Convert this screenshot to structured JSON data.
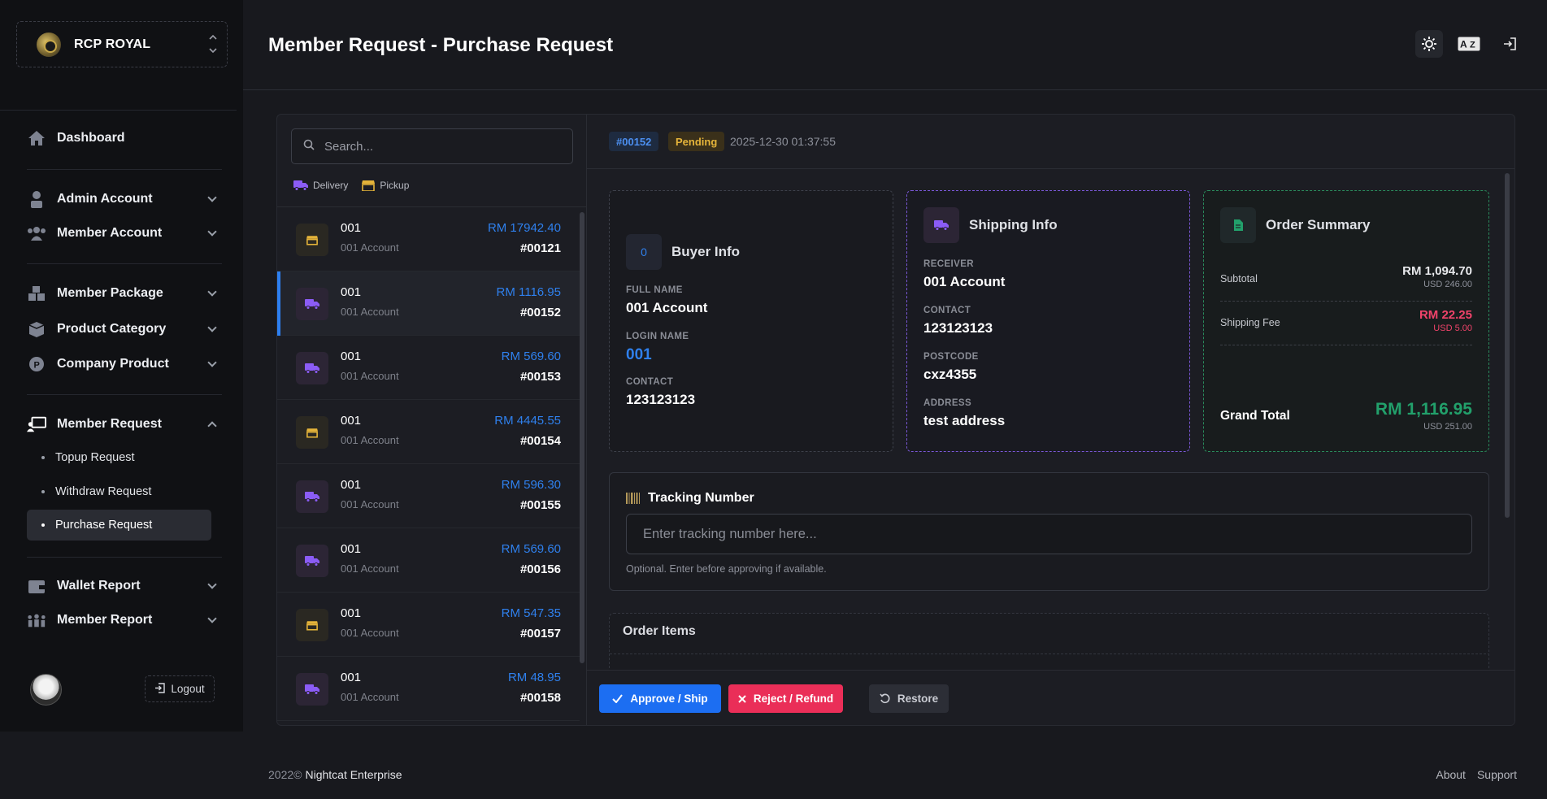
{
  "brand": {
    "name": "RCP ROYAL"
  },
  "sidebar": {
    "dashboard": "Dashboard",
    "admin_account": "Admin Account",
    "member_account": "Member Account",
    "member_package": "Member Package",
    "product_category": "Product Category",
    "company_product": "Company Product",
    "member_request": "Member Request",
    "sub_items": [
      "Topup Request",
      "Withdraw Request",
      "Purchase Request"
    ],
    "wallet_report": "Wallet Report",
    "member_report": "Member Report",
    "logout": "Logout"
  },
  "header": {
    "title": "Member Request - Purchase Request"
  },
  "list": {
    "search_placeholder": "Search...",
    "legend_delivery": "Delivery",
    "legend_pickup": "Pickup",
    "rows": [
      {
        "type": "pickup",
        "id": "001",
        "account": "001 Account",
        "amount": "RM 17942.40",
        "no": "#00121"
      },
      {
        "type": "delivery",
        "id": "001",
        "account": "001 Account",
        "amount": "RM 1116.95",
        "no": "#00152"
      },
      {
        "type": "delivery",
        "id": "001",
        "account": "001 Account",
        "amount": "RM 569.60",
        "no": "#00153"
      },
      {
        "type": "pickup",
        "id": "001",
        "account": "001 Account",
        "amount": "RM 4445.55",
        "no": "#00154"
      },
      {
        "type": "delivery",
        "id": "001",
        "account": "001 Account",
        "amount": "RM 596.30",
        "no": "#00155"
      },
      {
        "type": "delivery",
        "id": "001",
        "account": "001 Account",
        "amount": "RM 569.60",
        "no": "#00156"
      },
      {
        "type": "pickup",
        "id": "001",
        "account": "001 Account",
        "amount": "RM 547.35",
        "no": "#00157"
      },
      {
        "type": "delivery",
        "id": "001",
        "account": "001 Account",
        "amount": "RM 48.95",
        "no": "#00158"
      }
    ]
  },
  "detail": {
    "order_id": "#00152",
    "status": "Pending",
    "date": "2025-12-30 01:37:55",
    "buyer": {
      "title": "Buyer Info",
      "avatar": "0",
      "full_name_label": "FULL NAME",
      "full_name": "001 Account",
      "login_label": "LOGIN NAME",
      "login": "001",
      "contact_label": "CONTACT",
      "contact": "123123123"
    },
    "shipping": {
      "title": "Shipping Info",
      "receiver_label": "RECEIVER",
      "receiver": "001 Account",
      "contact_label": "CONTACT",
      "contact": "123123123",
      "postcode_label": "POSTCODE",
      "postcode": "cxz4355",
      "address_label": "ADDRESS",
      "address": "test address"
    },
    "summary": {
      "title": "Order Summary",
      "subtotal_label": "Subtotal",
      "subtotal": "RM 1,094.70",
      "subtotal_usd": "USD 246.00",
      "shipping_label": "Shipping Fee",
      "shipping": "RM 22.25",
      "shipping_usd": "USD 5.00",
      "grand_label": "Grand Total",
      "grand": "RM 1,116.95",
      "grand_usd": "USD 251.00"
    },
    "tracking": {
      "title": "Tracking Number",
      "placeholder": "Enter tracking number here...",
      "hint": "Optional. Enter before approving if available."
    },
    "items_title": "Order Items",
    "actions": {
      "approve": "Approve / Ship",
      "reject": "Reject / Refund",
      "restore": "Restore"
    }
  },
  "footer": {
    "year": "2022©",
    "company": "Nightcat Enterprise",
    "about": "About",
    "support": "Support"
  },
  "colors": {
    "accent": "#1c6ef2",
    "danger": "#ea2e58",
    "success": "#22a06b",
    "pending": "#e5b43a",
    "delivery": "#8b5cf6",
    "pickup": "#e5b43a"
  }
}
